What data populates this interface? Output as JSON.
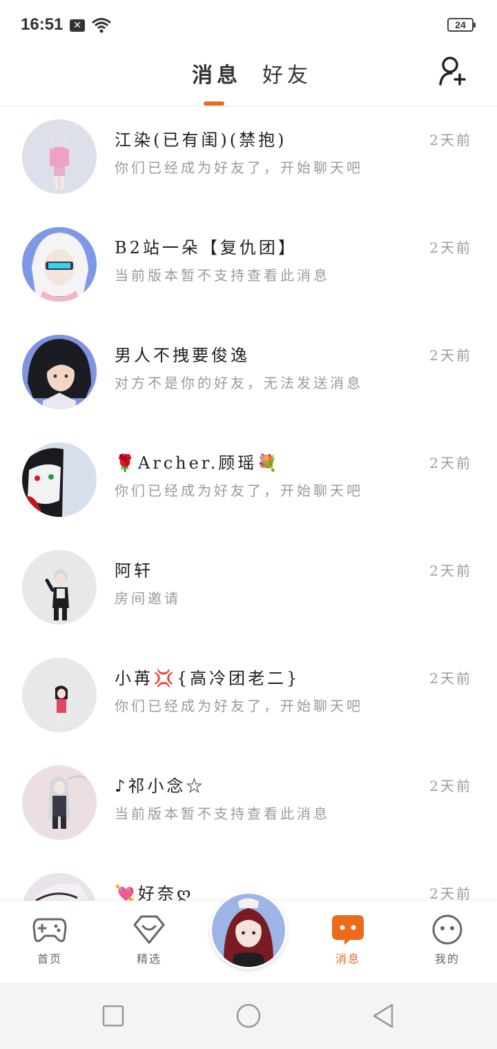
{
  "status_bar": {
    "time": "16:51",
    "battery": "24",
    "icons": [
      "notification-x-icon",
      "wifi-icon",
      "battery-icon"
    ]
  },
  "header": {
    "tabs": [
      {
        "label": "消息",
        "active": true
      },
      {
        "label": "好友",
        "active": false
      }
    ],
    "add_friend_icon": "add-person-icon",
    "accent_color": "#ee6a1b"
  },
  "chats": [
    {
      "name": "江染(已有闺)(禁抱)",
      "preview": "你们已经成为好友了，开始聊天吧",
      "time": "2天前"
    },
    {
      "name": "B2站一朵【复仇团】",
      "preview": "当前版本暂不支持查看此消息",
      "time": "2天前"
    },
    {
      "name": "男人不拽要俊逸",
      "preview": "对方不是你的好友，无法发送消息",
      "time": "2天前"
    },
    {
      "name": "🌹Archer.顾瑶💐",
      "preview": "你们已经成为好友了，开始聊天吧",
      "time": "2天前"
    },
    {
      "name": "阿轩",
      "preview": "房间邀请",
      "time": "2天前"
    },
    {
      "name": "小苒💢{高冷团老二}",
      "preview": "你们已经成为好友了，开始聊天吧",
      "time": "2天前"
    },
    {
      "name": "♪祁小念☆",
      "preview": "当前版本暂不支持查看此消息",
      "time": "2天前"
    },
    {
      "name": "💘好奈ღ",
      "preview": "",
      "time": "2天前"
    }
  ],
  "bottom_nav": {
    "items": [
      {
        "label": "首页",
        "icon": "gamepad-icon"
      },
      {
        "label": "精选",
        "icon": "heart-diamond-icon"
      },
      {
        "label": "消息",
        "icon": "chat-bubble-icon",
        "active": true
      },
      {
        "label": "我的",
        "icon": "smiley-face-icon"
      }
    ]
  },
  "system_nav": {
    "icons": [
      "recent-apps-icon",
      "home-icon",
      "back-icon"
    ]
  }
}
